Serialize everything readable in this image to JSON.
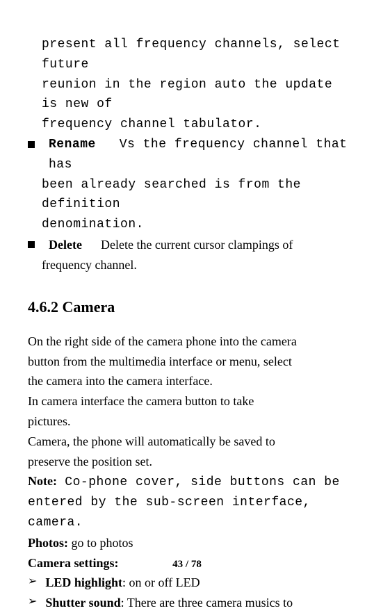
{
  "para1_a": "present all frequency channels, select future",
  "para1_b": "reunion in the region auto the update is new of",
  "para1_c": "frequency channel tabulator.",
  "bullet1_label": "Rename",
  "bullet1_text_a": "Vs the frequency channel that has",
  "bullet1_text_b": "been already searched is from the definition",
  "bullet1_text_c": "denomination.",
  "bullet2_label": "Delete",
  "bullet2_text_a": "Delete the current cursor clampings of",
  "bullet2_text_b": "frequency channel.",
  "section_title": "4.6.2 Camera",
  "para2_a": "On the right side of the camera phone into the camera",
  "para2_b": "button from the multimedia interface or menu, select",
  "para2_c": "the camera into the camera interface.",
  "para3_a": "In camera interface the camera button to take",
  "para3_b": "pictures.",
  "para4_a": "Camera, the phone will automatically be saved to",
  "para4_b": "preserve the position set.",
  "note_label": "Note:",
  "note_text_a": " Co-phone cover, side buttons can be",
  "note_text_b": "entered by the sub-screen interface, camera.",
  "photos_label": "Photos:",
  "photos_text": " go to photos",
  "camera_settings_label": "Camera settings:",
  "led_label": "LED highlight",
  "led_text": ": on or off LED",
  "shutter_label": "Shutter sound",
  "shutter_text": ": There are three camera musics to",
  "footer": "43 / 78"
}
